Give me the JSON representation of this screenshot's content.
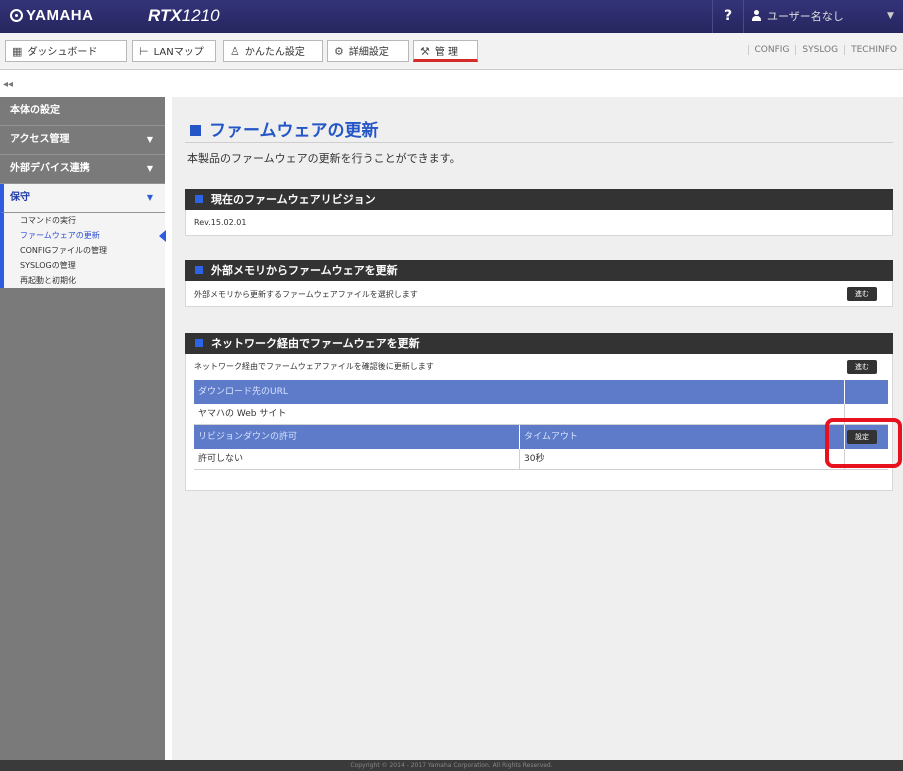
{
  "header": {
    "brand": "YAMAHA",
    "model_prefix": "RTX",
    "model_number": "1210",
    "help": "?",
    "user": "ユーザー名なし"
  },
  "toolbar": {
    "tabs": [
      {
        "label": "ダッシュボード",
        "icon": "dashboard-icon"
      },
      {
        "label": "LANマップ",
        "icon": "network-map-icon"
      },
      {
        "label": "かんたん設定",
        "icon": "wizard-icon"
      },
      {
        "label": "詳細設定",
        "icon": "gear-icon"
      },
      {
        "label": "管 理",
        "icon": "tools-icon"
      }
    ],
    "right_links": [
      "CONFIG",
      "SYSLOG",
      "TECHINFO"
    ],
    "collapse": "◂◂"
  },
  "sidebar": {
    "sections": [
      {
        "label": "本体の設定"
      },
      {
        "label": "アクセス管理"
      },
      {
        "label": "外部デバイス連携"
      },
      {
        "label": "保守"
      }
    ],
    "items": [
      {
        "label": "コマンドの実行"
      },
      {
        "label": "ファームウェアの更新"
      },
      {
        "label": "CONFIGファイルの管理"
      },
      {
        "label": "SYSLOGの管理"
      },
      {
        "label": "再起動と初期化"
      }
    ]
  },
  "main": {
    "title": "ファームウェアの更新",
    "description": "本製品のファームウェアの更新を行うことができます。",
    "current": {
      "heading": "現在のファームウェアリビジョン",
      "revision": "Rev.15.02.01"
    },
    "external": {
      "heading": "外部メモリからファームウェアを更新",
      "text": "外部メモリから更新するファームウェアファイルを選択します",
      "button": "進む"
    },
    "network": {
      "heading": "ネットワーク経由でファームウェアを更新",
      "text": "ネットワーク経由でファームウェアファイルを確認後に更新します",
      "button": "進む",
      "url_header": "ダウンロード先のURL",
      "url_value": "ヤマハの Web サイト",
      "revdown_header": "リビジョンダウンの許可",
      "timeout_header": "タイムアウト",
      "revdown_value": "許可しない",
      "timeout_value": "30秒",
      "settings_button": "設定"
    }
  },
  "footer": "Copyright © 2014 - 2017 Yamaha Corporation. All Rights Reserved."
}
